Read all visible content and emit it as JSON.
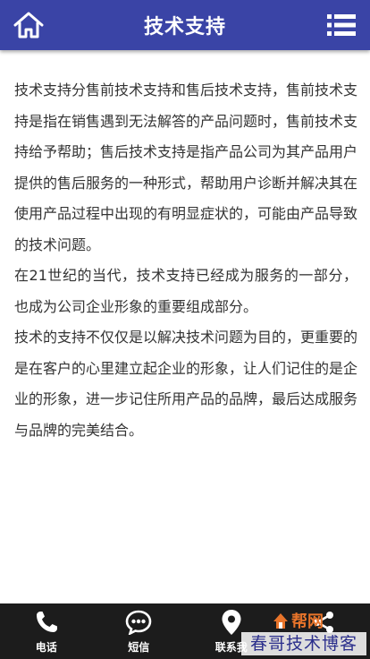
{
  "header": {
    "title": "技术支持",
    "home_icon": "home-icon",
    "menu_icon": "menu-icon",
    "background_color": "#3a44a6"
  },
  "content": {
    "paragraphs": [
      "技术支持分售前技术支持和售后技术支持，售前技术支持是指在销售遇到无法解答的产品问题时，售前技术支持给予帮助；售后技术支持是指产品公司为其产品用户提供的售后服务的一种形式，帮助用户诊断并解决其在使用产品过程中出现的有明显症状的，可能由产品导致的技术问题。",
      "在21世纪的当代，技术支持已经成为服务的一部分，也成为公司企业形象的重要组成部分。",
      "技术的支持不仅仅是以解决技术问题为目的，更重要的是在客户的心里建立起企业的形象，让人们记住的是企业的形象，进一步记住所用产品的品牌，最后达成服务与品牌的完美结合。"
    ]
  },
  "footer": {
    "items": [
      {
        "label": "电话",
        "icon": "phone-icon"
      },
      {
        "label": "短信",
        "icon": "sms-icon"
      },
      {
        "label": "联系我",
        "icon": "location-pin-icon"
      },
      {
        "label": "",
        "icon": "share-icon"
      }
    ],
    "background_color": "#1c1c1c"
  },
  "watermark": {
    "logo_text": "帮网",
    "text": "春哥技术博客"
  }
}
